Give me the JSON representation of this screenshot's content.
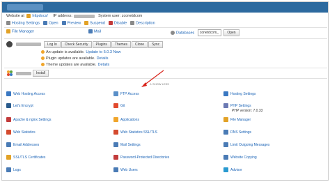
{
  "header": {
    "domain_title": "",
    "website_label": "Website at",
    "folder_link": "httpdocs/",
    "ip_label": "IP address:",
    "system_user_label": "System user: zconetdcom"
  },
  "actions": [
    {
      "label": "Hosting Settings",
      "icon": "gear-icon"
    },
    {
      "label": "Open",
      "icon": "open-icon"
    },
    {
      "label": "Preview",
      "icon": "preview-icon"
    },
    {
      "label": "Suspend",
      "icon": "suspend-icon"
    },
    {
      "label": "Disable",
      "icon": "disable-icon"
    },
    {
      "label": "Description",
      "icon": "description-icon"
    }
  ],
  "row2": {
    "file_manager": "File Manager",
    "mail": "Mail",
    "databases": "Databases",
    "db_selected": "conetdcom_",
    "open_button": "Open"
  },
  "wordpress": {
    "buttons": [
      "Log In",
      "Check Security",
      "Plugins",
      "Themes",
      "Clone",
      "Sync"
    ],
    "notices": [
      {
        "text": "An update is available.",
        "link": "Update to 5.0.3 Now"
      },
      {
        "text": "Plugin updates are available.",
        "link": "Details"
      },
      {
        "text": "Theme updates are available.",
        "link": "Details"
      }
    ]
  },
  "joomla": {
    "install_button": "Install"
  },
  "show_less": "∧ SHOW LESS",
  "tools": [
    {
      "label": "Web Hosting Access",
      "color": "#3a78c2"
    },
    {
      "label": "FTP Access",
      "color": "#5a8fc8"
    },
    {
      "label": "Hosting Settings",
      "color": "#3a78c2"
    },
    {
      "label": "Let's Encrypt",
      "color": "#2a5b8c"
    },
    {
      "label": "Git",
      "color": "#e24a2d"
    },
    {
      "label": "PHP Settings",
      "color": "#6b79b3"
    },
    {
      "label": "Apache & nginx Settings",
      "color": "#c23b3b"
    },
    {
      "label": "Applications",
      "color": "#f0a52b"
    },
    {
      "label": "File Manager",
      "color": "#e2a227"
    },
    {
      "label": "Web Statistics",
      "color": "#d44a2e"
    },
    {
      "label": "Web Statistics SSL/TLS",
      "color": "#d44a2e"
    },
    {
      "label": "DNS Settings",
      "color": "#4a7bb5"
    },
    {
      "label": "Email Addresses",
      "color": "#4a7bb5"
    },
    {
      "label": "Mail Settings",
      "color": "#4a7bb5"
    },
    {
      "label": "Limit Outgoing Messages",
      "color": "#4a7bb5"
    },
    {
      "label": "SSL/TLS Certificates",
      "color": "#e2a227"
    },
    {
      "label": "Password-Protected Directories",
      "color": "#c23b3b"
    },
    {
      "label": "Website Copying",
      "color": "#4a7bb5"
    },
    {
      "label": "Logs",
      "color": "#4a7bb5"
    },
    {
      "label": "Web Users",
      "color": "#4a7bb5"
    },
    {
      "label": "Advisor",
      "color": "#2a9ad0"
    }
  ],
  "php_version": "PHP version: 7.0.33"
}
